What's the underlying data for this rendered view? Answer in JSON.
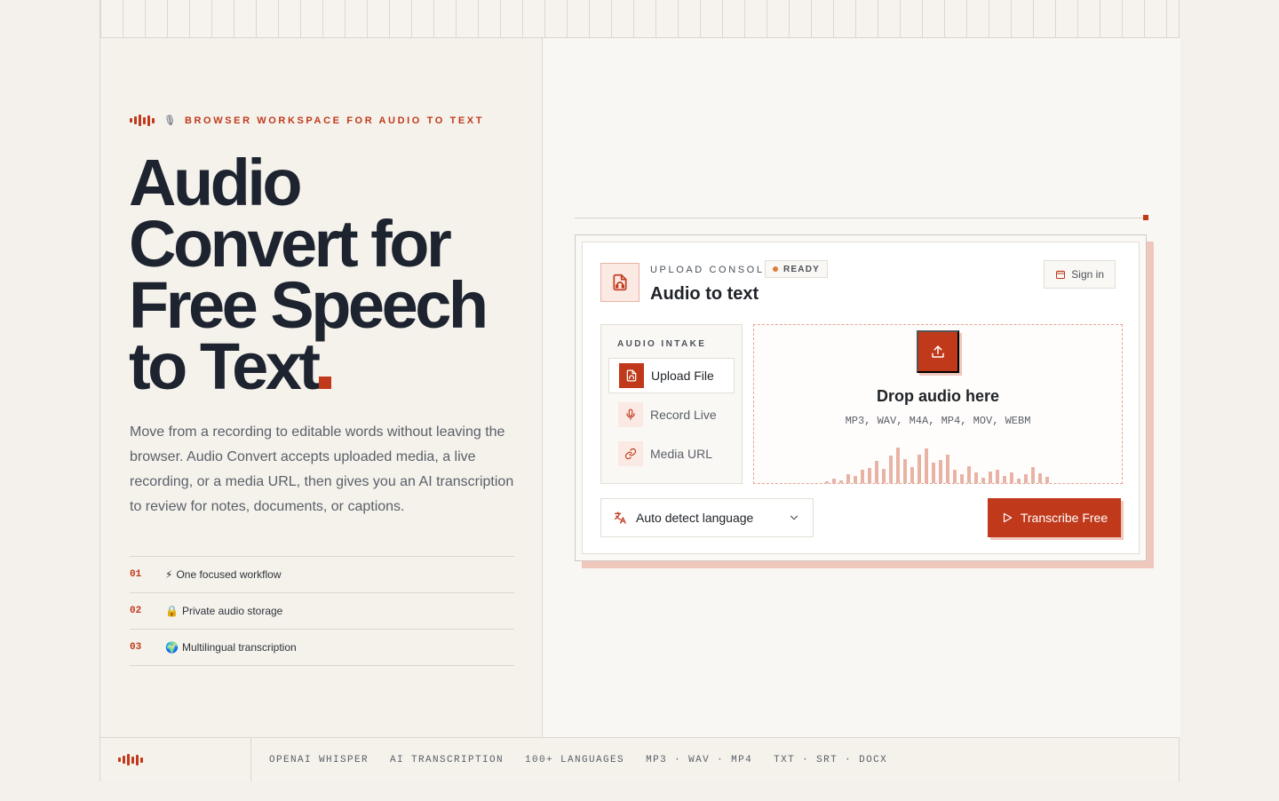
{
  "brand": {
    "accent": "#c0391b"
  },
  "hero": {
    "eyebrow": "BROWSER WORKSPACE FOR AUDIO TO TEXT",
    "headline": [
      "Audio",
      "Convert for",
      "Free Speech",
      "to Text"
    ],
    "description": "Move from a recording to editable words without leaving the browser. Audio Convert accepts uploaded media, a live recording, or a media URL, then gives you an AI transcription to review for notes, documents, or captions.",
    "features": [
      {
        "num": "01",
        "icon": "⚡",
        "label": "One focused workflow"
      },
      {
        "num": "02",
        "icon": "🔒",
        "label": "Private audio storage"
      },
      {
        "num": "03",
        "icon": "🌍",
        "label": "Multilingual transcription"
      }
    ]
  },
  "console": {
    "label": "UPLOAD CONSOLE",
    "status": "READY",
    "title": "Audio to text",
    "signin_label": "Sign in",
    "intake_label": "AUDIO INTAKE",
    "intake_items": [
      {
        "label": "Upload File",
        "icon": "file-audio-icon"
      },
      {
        "label": "Record Live",
        "icon": "mic-icon"
      },
      {
        "label": "Media URL",
        "icon": "link-icon"
      }
    ],
    "drop_title": "Drop audio here",
    "formats": "MP3, WAV, M4A, MP4, MOV, WEBM",
    "language": "Auto detect language",
    "transcribe_label": "Transcribe Free"
  },
  "footer": {
    "tags": [
      "OPENAI WHISPER",
      "AI TRANSCRIPTION",
      "100+ LANGUAGES",
      "MP3 · WAV · MP4",
      "TXT · SRT · DOCX"
    ]
  }
}
